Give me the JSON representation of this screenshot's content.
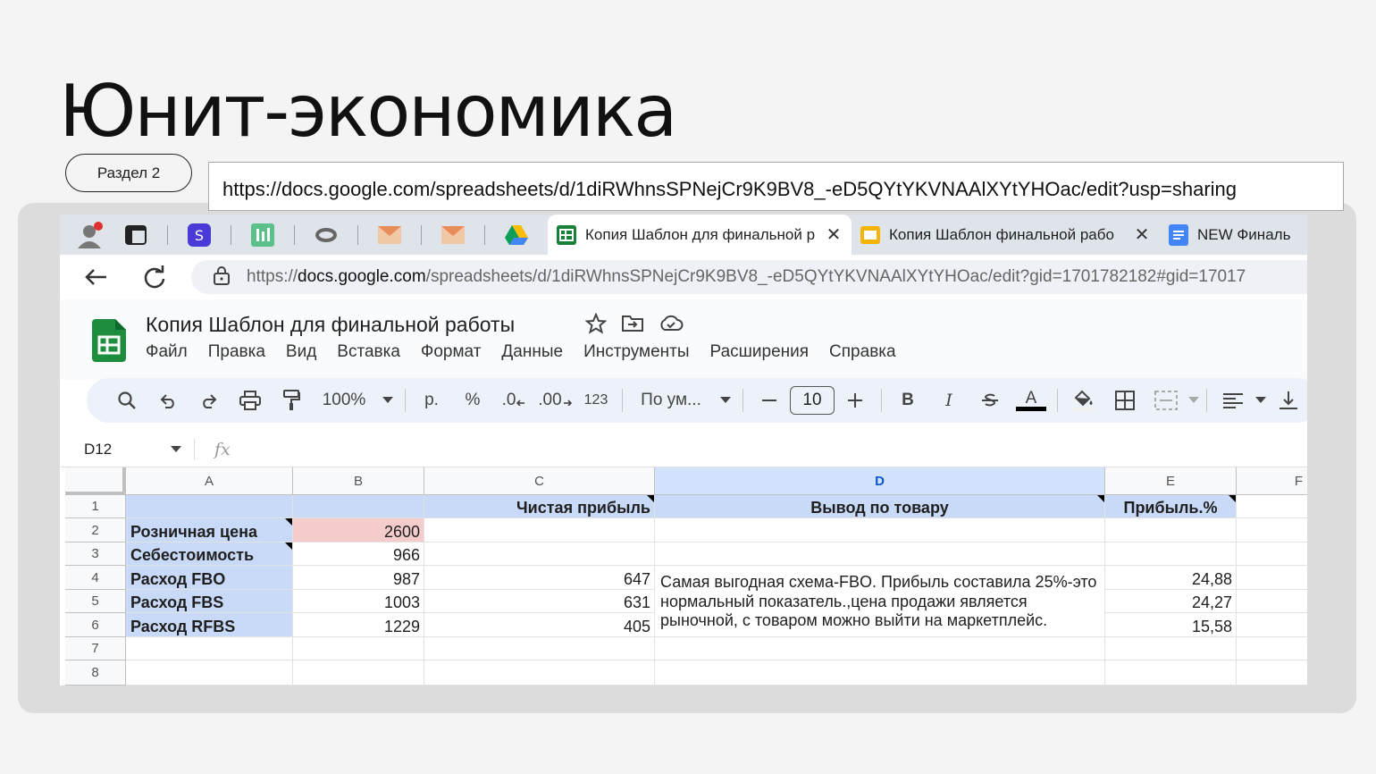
{
  "slide": {
    "title": "Юнит-экономика",
    "section": "Раздел 2",
    "link": "https://docs.google.com/spreadsheets/d/1diRWhnsSPNejCr9K9BV8_-eD5QYtYKVNAAlXYtYHOac/edit?usp=sharing"
  },
  "tabs": {
    "active_label": "Копия Шаблон для финальной р",
    "second_label": "Копия Шаблон финальной рабо",
    "third_label": "NEW Финаль",
    "close_glyph": "✕"
  },
  "address": {
    "url_prefix": "https://",
    "url_domain": "docs.google.com",
    "url_rest": "/spreadsheets/d/1diRWhnsSPNejCr9K9BV8_-eD5QYtYKVNAAlXYtYHOac/edit?gid=1701782182#gid=17017"
  },
  "doc": {
    "title": "Копия Шаблон для финальной работы",
    "menu": [
      "Файл",
      "Правка",
      "Вид",
      "Вставка",
      "Формат",
      "Данные",
      "Инструменты",
      "Расширения",
      "Справка"
    ]
  },
  "toolbar": {
    "zoom": "100%",
    "currency": "р.",
    "percent": "%",
    "dec_less": ".0",
    "dec_more": ".00",
    "number_format": "123",
    "font": "По ум...",
    "font_size": "10",
    "bold": "B",
    "italic": "I",
    "text_color": "A"
  },
  "formula": {
    "cell_ref": "D12",
    "fx": "fx"
  },
  "sheet": {
    "columns": [
      "A",
      "B",
      "C",
      "D",
      "E",
      "F"
    ],
    "rows": [
      "1",
      "2",
      "3",
      "4",
      "5",
      "6",
      "7",
      "8"
    ],
    "C1": "Чистая прибыль",
    "D1": "Вывод по товару",
    "E1": "Прибыль.%",
    "A2": "Розничная цена",
    "B2": "2600",
    "A3": "Себестоимость",
    "B3": "966",
    "A4": "Расход FBO",
    "B4": "987",
    "C4": "647",
    "E4": "24,88",
    "A5": "Расход FBS",
    "B5": "1003",
    "C5": "631",
    "E5": "24,27",
    "A6": "Расход RFBS",
    "B6": "1229",
    "C6": "405",
    "E6": "15,58",
    "D4": "Самая выгодная схема-FBO. Прибыль составила 25%-это нормальный показатель.,цена продажи является рыночной, с товаром можно выйти на маркетплейс."
  },
  "colors": {
    "header_blue": "#c9daf8",
    "price_pink": "#f4cccc",
    "sheets_green": "#188038"
  }
}
